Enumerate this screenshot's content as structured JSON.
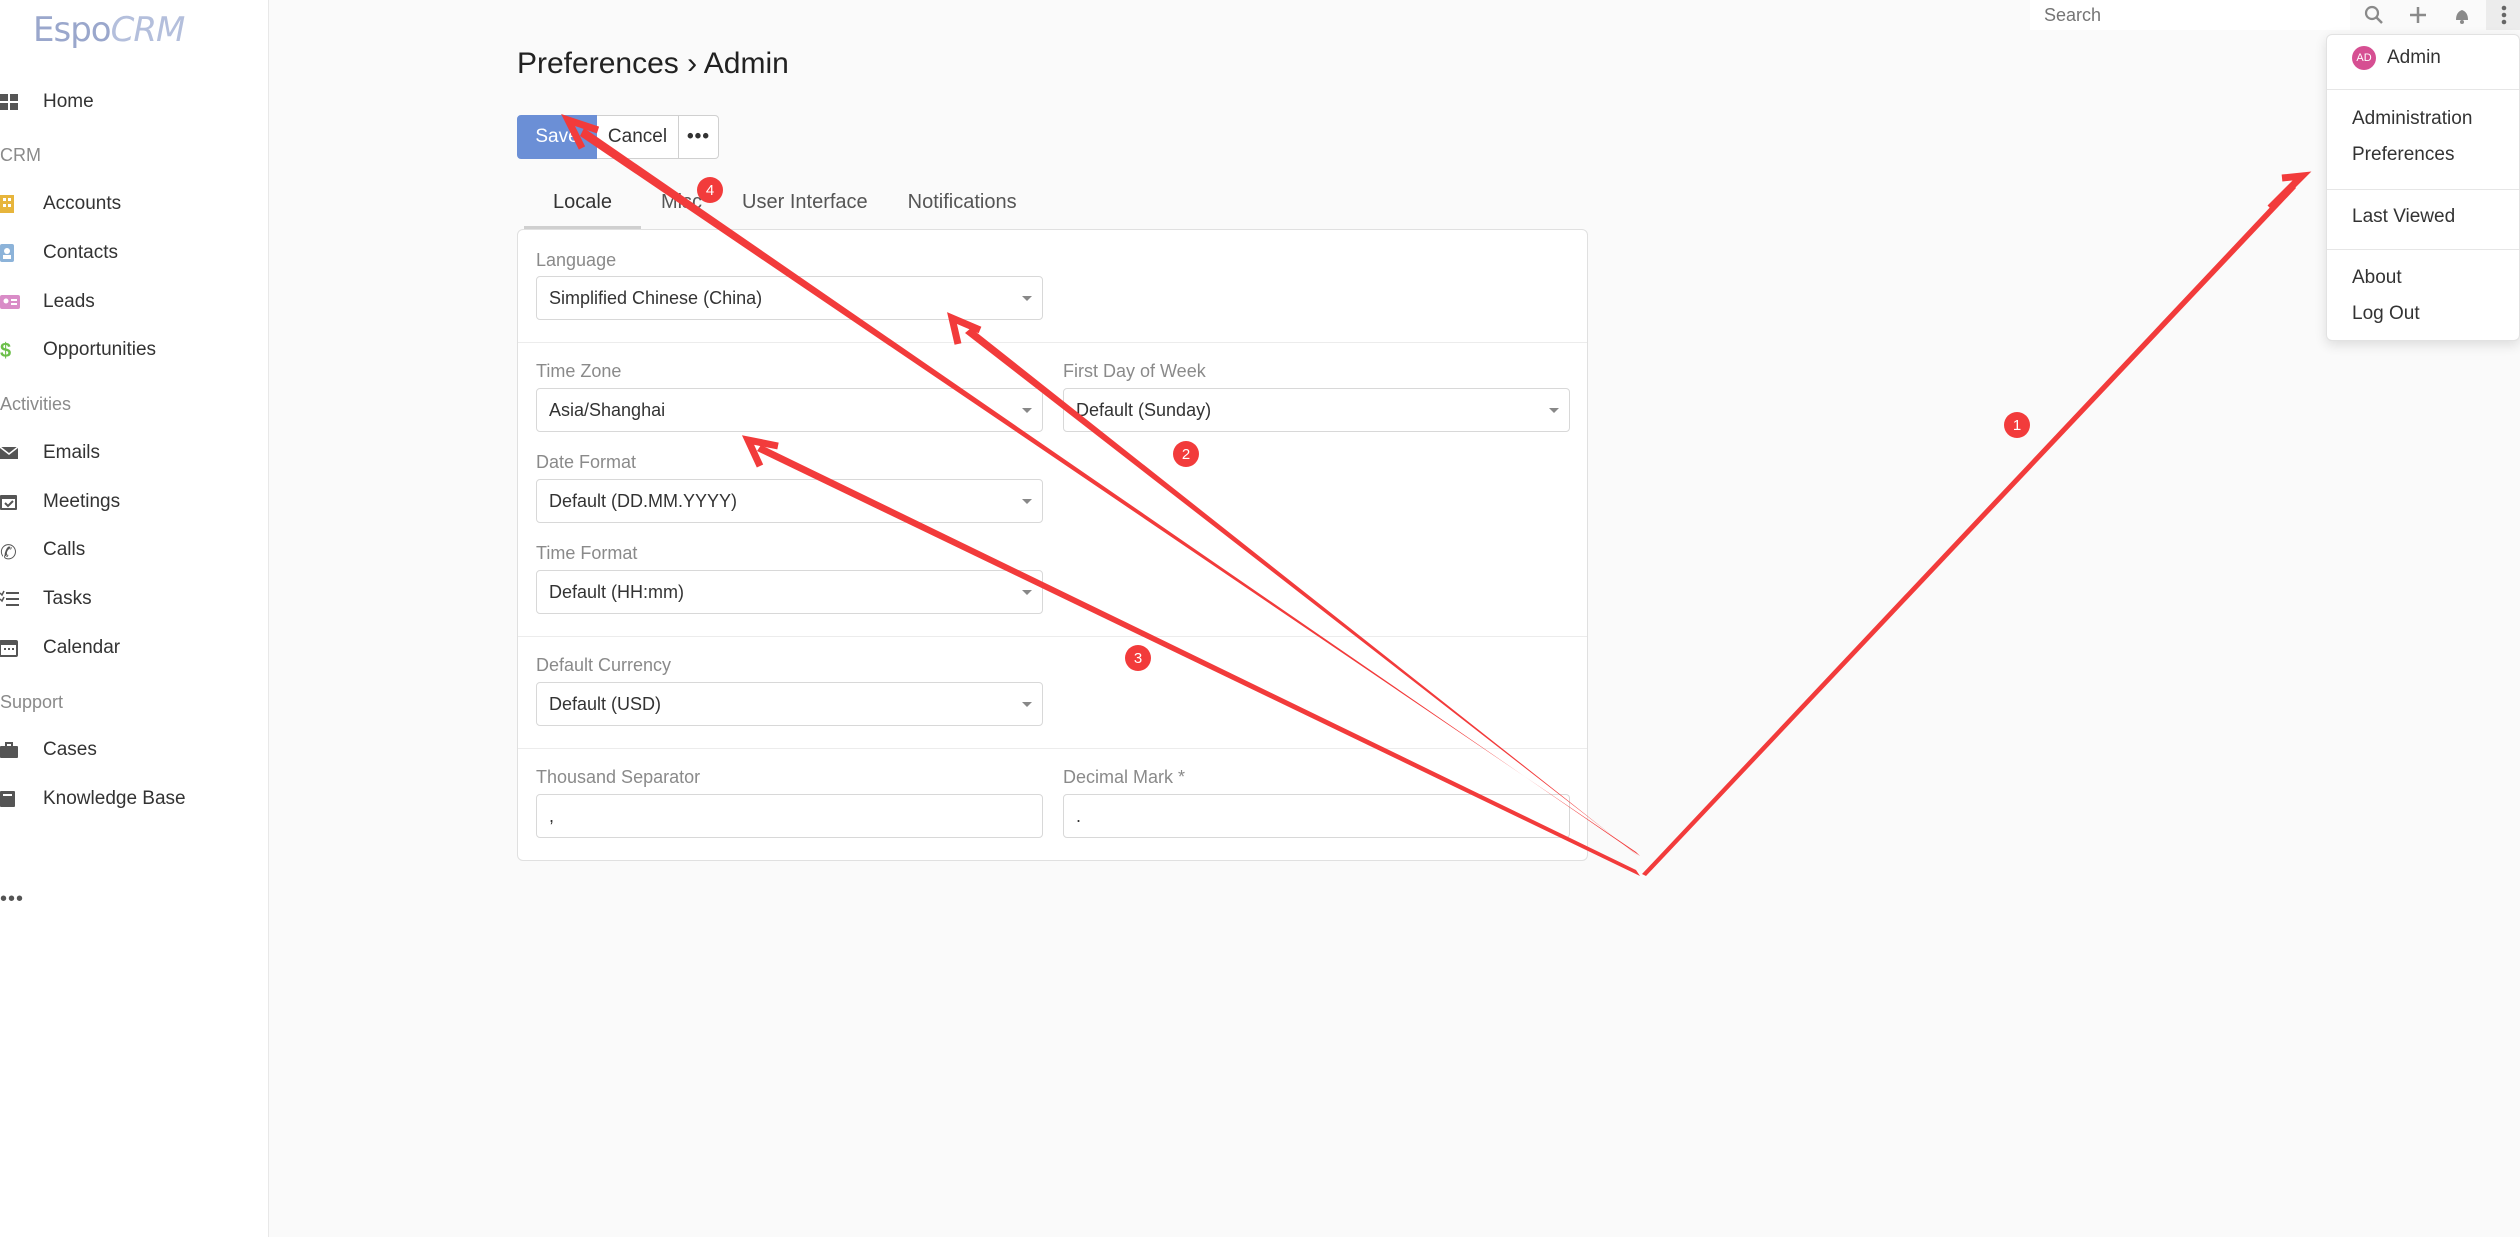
{
  "sidebar": {
    "logo": {
      "espo": "Espo",
      "crm": "CRM"
    },
    "home": "Home",
    "groups": {
      "crm": "CRM",
      "activities": "Activities",
      "support": "Support"
    },
    "items": {
      "accounts": "Accounts",
      "contacts": "Contacts",
      "leads": "Leads",
      "opportunities": "Opportunities",
      "emails": "Emails",
      "meetings": "Meetings",
      "calls": "Calls",
      "tasks": "Tasks",
      "calendar": "Calendar",
      "cases": "Cases",
      "knowledge_base": "Knowledge Base"
    },
    "more": "•••"
  },
  "topbar": {
    "search_placeholder": "Search"
  },
  "page": {
    "title": "Preferences › Admin",
    "buttons": {
      "save": "Save",
      "cancel": "Cancel",
      "more": "•••"
    },
    "tabs": [
      "Locale",
      "Misc",
      "User Interface",
      "Notifications"
    ]
  },
  "form": {
    "language": {
      "label": "Language",
      "value": "Simplified Chinese (China)"
    },
    "time_zone": {
      "label": "Time Zone",
      "value": "Asia/Shanghai"
    },
    "first_day_of_week": {
      "label": "First Day of Week",
      "value": "Default (Sunday)"
    },
    "date_format": {
      "label": "Date Format",
      "value": "Default (DD.MM.YYYY)"
    },
    "time_format": {
      "label": "Time Format",
      "value": "Default (HH:mm)"
    },
    "default_currency": {
      "label": "Default Currency",
      "value": "Default (USD)"
    },
    "thousand_separator": {
      "label": "Thousand Separator",
      "value": ","
    },
    "decimal_mark": {
      "label": "Decimal Mark *",
      "value": "."
    }
  },
  "user_menu": {
    "avatar_initials": "AD",
    "user": "Admin",
    "administration": "Administration",
    "preferences": "Preferences",
    "last_viewed": "Last Viewed",
    "about": "About",
    "log_out": "Log Out"
  },
  "annotations": {
    "markers": [
      "1",
      "2",
      "3",
      "4"
    ],
    "color": "#f23b3b"
  }
}
